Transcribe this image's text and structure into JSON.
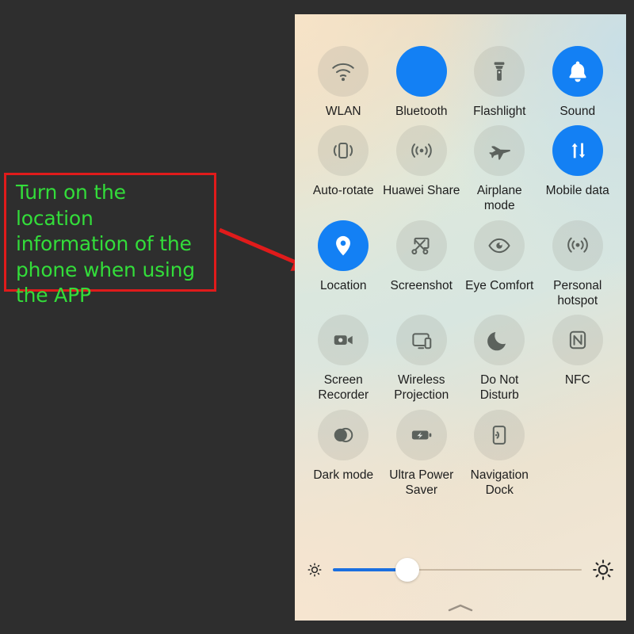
{
  "annotation": {
    "text": "Turn on the location\ninformation of the\nphone when using\nthe APP",
    "box_color": "#e01b1b",
    "text_color": "#33dd3a",
    "arrow_color": "#e01b1b",
    "arrow_target": "location-tile"
  },
  "panel": {
    "name": "quick-settings-panel",
    "accent_color": "#1380f4",
    "background_note": "pastel cream to mint to blue gradient"
  },
  "tiles": [
    [
      {
        "label": "WLAN",
        "icon": "wifi-icon",
        "state": "off"
      },
      {
        "label": "Bluetooth",
        "icon": "bluetooth-icon",
        "state": "on"
      },
      {
        "label": "Flashlight",
        "icon": "flashlight-icon",
        "state": "off"
      },
      {
        "label": "Sound",
        "icon": "bell-icon",
        "state": "on"
      }
    ],
    [
      {
        "label": "Auto-rotate",
        "icon": "auto-rotate-icon",
        "state": "off"
      },
      {
        "label": "Huawei Share",
        "icon": "huawei-share-icon",
        "state": "off"
      },
      {
        "label": "Airplane mode",
        "icon": "airplane-icon",
        "state": "off"
      },
      {
        "label": "Mobile data",
        "icon": "mobile-data-icon",
        "state": "on"
      }
    ],
    [
      {
        "label": "Location",
        "icon": "location-pin-icon",
        "state": "on"
      },
      {
        "label": "Screenshot",
        "icon": "screenshot-icon",
        "state": "off"
      },
      {
        "label": "Eye Comfort",
        "icon": "eye-icon",
        "state": "off"
      },
      {
        "label": "Personal hotspot",
        "icon": "hotspot-icon",
        "state": "off"
      }
    ],
    [
      {
        "label": "Screen Recorder",
        "icon": "video-camera-icon",
        "state": "off"
      },
      {
        "label": "Wireless Projection",
        "icon": "cast-icon",
        "state": "off"
      },
      {
        "label": "Do Not Disturb",
        "icon": "moon-icon",
        "state": "off"
      },
      {
        "label": "NFC",
        "icon": "nfc-icon",
        "state": "off"
      }
    ],
    [
      {
        "label": "Dark mode",
        "icon": "dark-mode-icon",
        "state": "off"
      },
      {
        "label": "Ultra Power Saver",
        "icon": "battery-bolt-icon",
        "state": "off"
      },
      {
        "label": "Navigation Dock",
        "icon": "navigation-dock-icon",
        "state": "off"
      }
    ]
  ],
  "brightness": {
    "name": "brightness-slider",
    "value_percent": 30,
    "low_icon": "sun-small-icon",
    "high_icon": "sun-large-icon",
    "fill_color": "#1a6fe0"
  },
  "handle": {
    "icon": "chevron-up-icon"
  }
}
